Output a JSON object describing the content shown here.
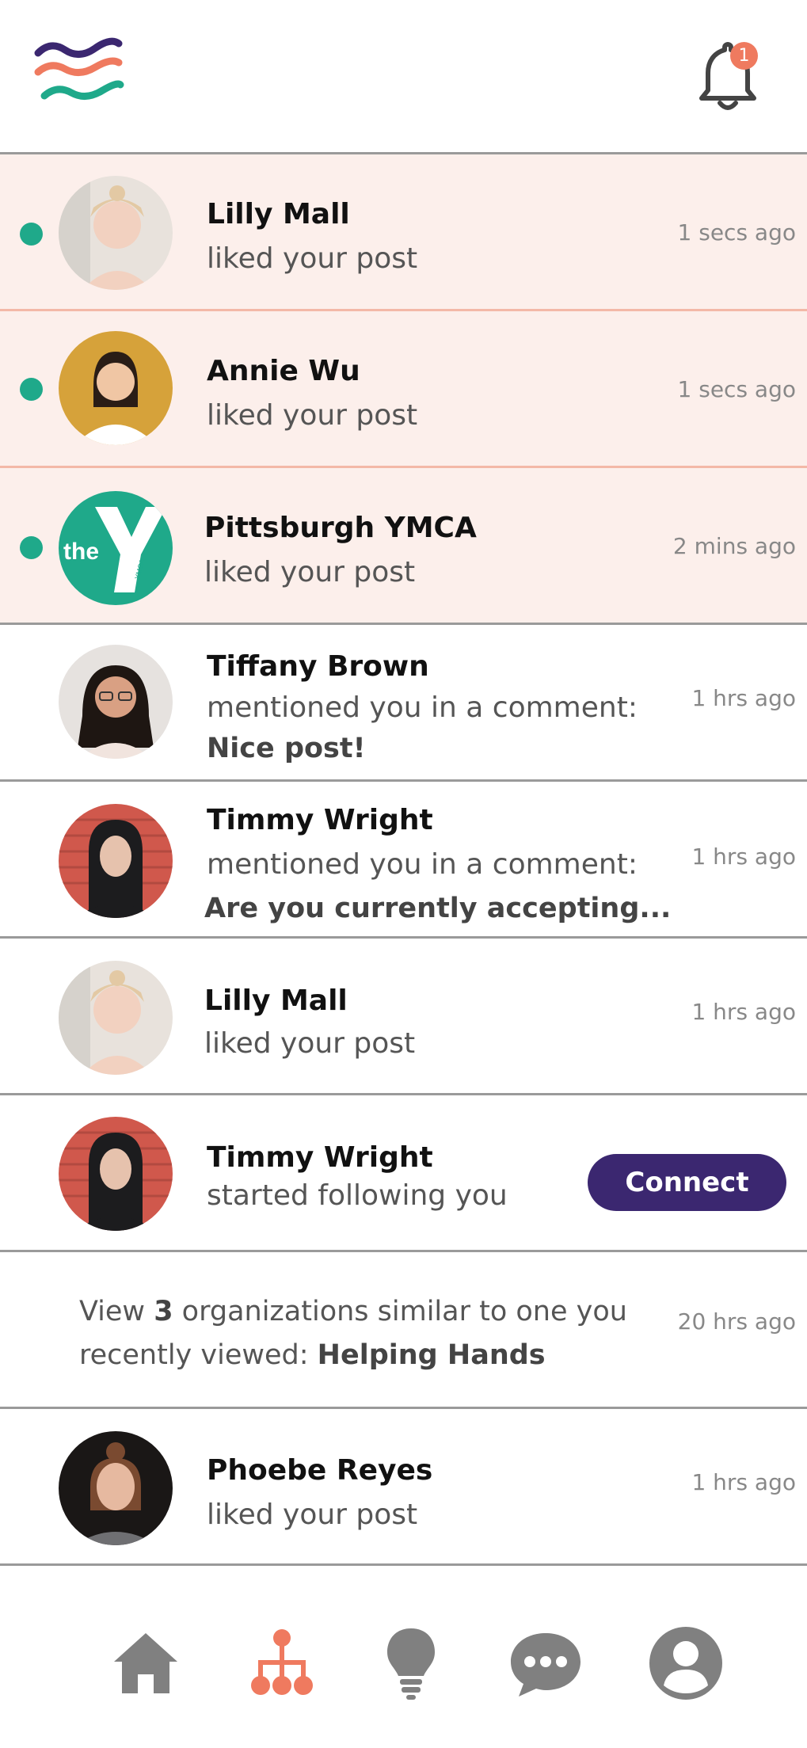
{
  "header": {
    "logo": "waves-logo",
    "notification_count": "1",
    "colors": {
      "logo_purple": "#3b2770",
      "logo_coral": "#ef7a5f",
      "logo_teal": "#1fa98a"
    }
  },
  "notifications": [
    {
      "name": "Lilly Mall",
      "action": "liked your post",
      "time": "1 secs ago",
      "unread": true
    },
    {
      "name": "Annie Wu",
      "action": "liked your post",
      "time": "1 secs ago",
      "unread": true
    },
    {
      "name": "Pittsburgh YMCA",
      "action": "liked your post",
      "time": "2 mins ago",
      "unread": true,
      "avatar_text": "the",
      "avatar_small": "YMCA"
    },
    {
      "name": "Tiffany Brown",
      "action": "mentioned you in a comment:",
      "comment": "Nice post!",
      "time": "1 hrs ago",
      "unread": false
    },
    {
      "name": "Timmy Wright",
      "action": "mentioned you in a comment:",
      "comment": "Are you currently accepting...",
      "time": "1 hrs ago",
      "unread": false
    },
    {
      "name": "Lilly Mall",
      "action": "liked your post",
      "time": "1 hrs ago",
      "unread": false
    },
    {
      "name": "Timmy Wright",
      "action": "started following you",
      "button": "Connect",
      "unread": false
    },
    {
      "suggest_pre": "View ",
      "suggest_count": "3",
      "suggest_mid": " organizations similar to one you",
      "suggest_pre2": "recently viewed: ",
      "suggest_org": "Helping Hands",
      "time": "20 hrs ago",
      "unread": false
    },
    {
      "name": "Phoebe Reyes",
      "action": "liked your post",
      "time": "1 hrs ago",
      "unread": false
    }
  ],
  "nav": {
    "items": [
      "home-icon",
      "network-icon",
      "lightbulb-icon",
      "chat-icon",
      "profile-icon"
    ],
    "active": "network-icon",
    "colors": {
      "active": "#ef7a5f",
      "inactive": "#808080"
    }
  },
  "colors": {
    "unread_bg": "#fcefeb",
    "unread_dot": "#1fa98a",
    "button": "#3b2770"
  }
}
